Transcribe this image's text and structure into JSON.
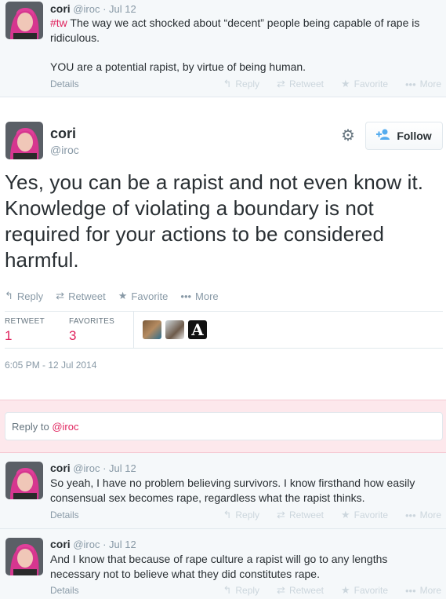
{
  "tweets": [
    {
      "name": "cori",
      "handle": "@iroc",
      "date": "· Jul 12",
      "hashtag": "#tw",
      "text": " The way we act shocked about “decent” people being capable of rape is ridiculous.",
      "text2": "YOU are a potential rapist, by virtue of being human.",
      "details": "Details"
    },
    {
      "name": "cori",
      "handle": "@iroc",
      "date": "· Jul 12",
      "text": "So yeah, I have no problem believing survivors. I know firsthand how easily consensual sex becomes rape, regardless what the rapist thinks.",
      "details": "Details"
    },
    {
      "name": "cori",
      "handle": "@iroc",
      "date": "· Jul 12",
      "text": "And I know that because of rape culture a rapist will go to any lengths necessary not to believe what they did constitutes rape.",
      "details": "Details"
    }
  ],
  "actions": {
    "reply": "Reply",
    "retweet": "Retweet",
    "favorite": "Favorite",
    "more": "More"
  },
  "main": {
    "name": "cori",
    "handle": "@iroc",
    "follow": "Follow",
    "text": "Yes, you can be a rapist and not even know it. Knowledge of violating a boundary is not required for your actions to be considered harmful.",
    "retweet_label": "RETWEET",
    "retweet_count": "1",
    "favorites_label": "FAVORITES",
    "favorites_count": "3",
    "timestamp": "6:05 PM - 12 Jul 2014",
    "favoriter_initial": "A"
  },
  "reply": {
    "prefix": "Reply to ",
    "mention": "@iroc"
  },
  "colors": {
    "accent": "#e0245e",
    "muted": "#8899a6",
    "link_blue": "#55acee"
  },
  "icons": [
    "reply-icon",
    "retweet-icon",
    "favorite-icon",
    "more-icon",
    "gear-icon",
    "follow-person-icon"
  ]
}
